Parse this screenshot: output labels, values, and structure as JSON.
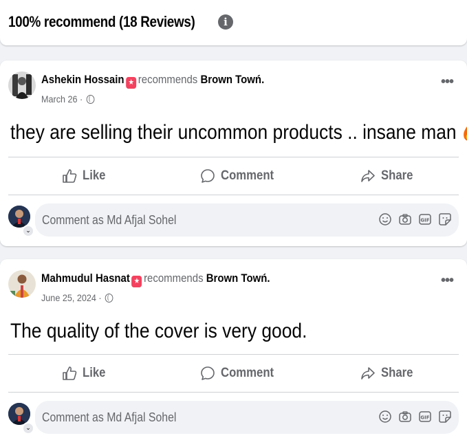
{
  "header": {
    "title": "100% recommend (18 Reviews)",
    "info_icon": "info-icon"
  },
  "posts": [
    {
      "author": "Ashekin Hossain",
      "recommend_word": "recommends",
      "page": "Brown Towń.",
      "date": "March 26 ·",
      "text": "they are selling their uncommon products .. insane man",
      "emoji": [
        "fire-icon",
        "fire-icon"
      ],
      "actions": {
        "like": "Like",
        "comment": "Comment",
        "share": "Share"
      },
      "comment_placeholder": "Comment as Md Afjal Sohel"
    },
    {
      "author": "Mahmudul Hasnat",
      "recommend_word": "recommends",
      "page": "Brown Towń.",
      "date": "June 25, 2024 ·",
      "text": "The quality of the cover is very good.",
      "emoji": [],
      "actions": {
        "like": "Like",
        "comment": "Comment",
        "share": "Share"
      },
      "comment_placeholder": "Comment as Md Afjal Sohel"
    }
  ],
  "colors": {
    "background": "#f0f2f5",
    "card": "#ffffff",
    "secondary_text": "#65676b",
    "recommend_badge": "#f3425f"
  }
}
